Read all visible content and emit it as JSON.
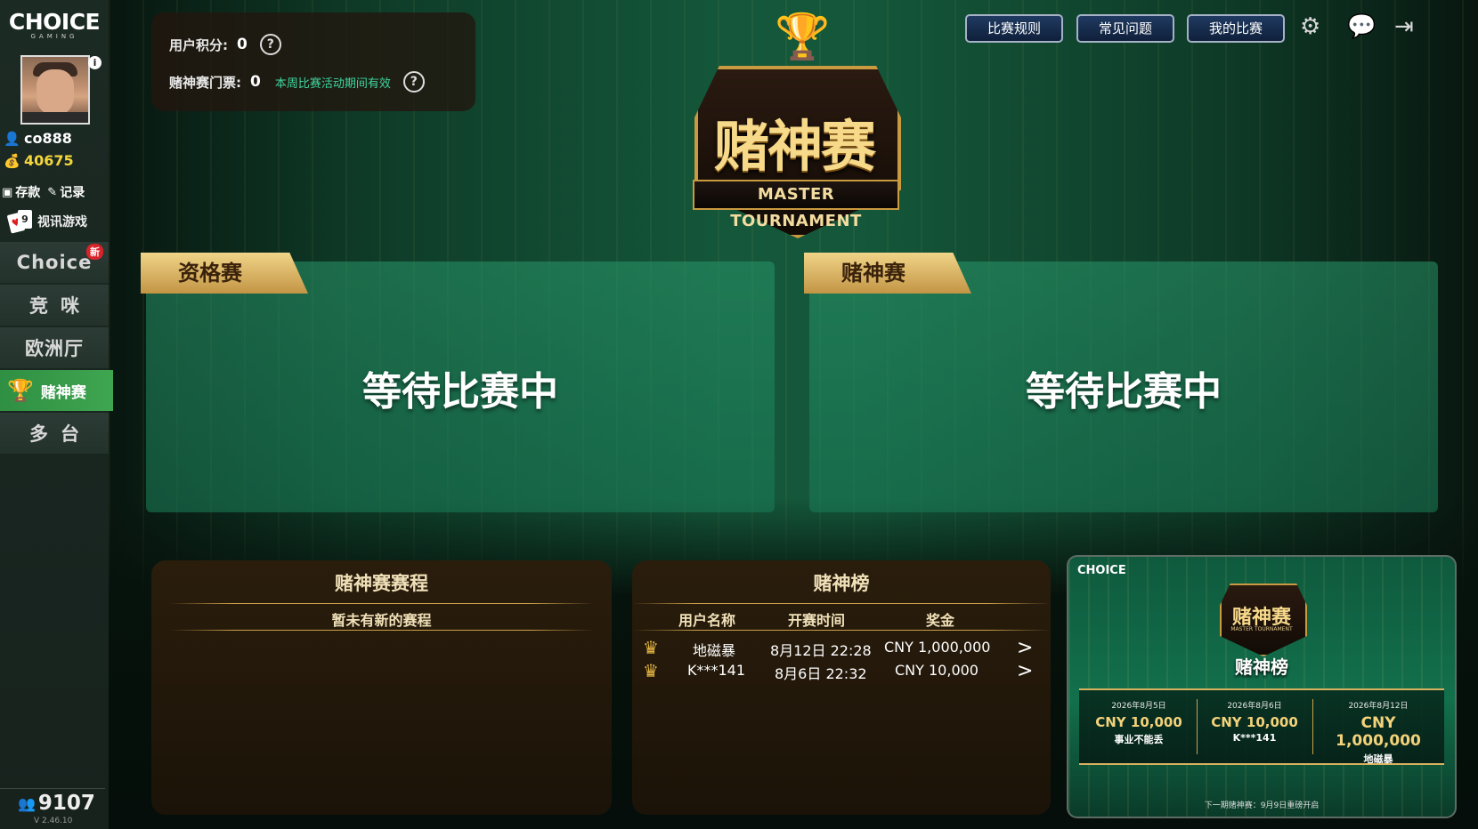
{
  "sidebar": {
    "logo_main": "CHOICE",
    "logo_sub": "GAMING",
    "info_icon": "i",
    "username": "co888",
    "balance": "40675",
    "deposit_label": "存款",
    "records_label": "记录",
    "video_games_label": "视讯游戏",
    "nav": [
      {
        "label": "Choice",
        "badge": "新"
      },
      {
        "label": "竞咪"
      },
      {
        "label": "欧洲厅"
      },
      {
        "label": "赌神赛",
        "active": true
      },
      {
        "label": "多台"
      }
    ],
    "online_count": "9107",
    "version": "V 2.46.10"
  },
  "info_box": {
    "points_label": "用户积分:",
    "points_value": "0",
    "ticket_label": "赌神赛门票:",
    "ticket_value": "0",
    "ticket_note": "本周比赛活动期间有效"
  },
  "header": {
    "rules_button": "比赛规则",
    "faq_button": "常见问题",
    "my_matches_button": "我的比赛"
  },
  "emblem": {
    "title": "赌神赛",
    "subtitle": "MASTER TOURNAMENT"
  },
  "panels": [
    {
      "tab": "资格赛",
      "status": "等待比赛中"
    },
    {
      "tab": "赌神赛",
      "status": "等待比赛中"
    }
  ],
  "schedule": {
    "title": "赌神赛赛程",
    "empty_text": "暂未有新的赛程"
  },
  "leaderboard": {
    "title": "赌神榜",
    "columns": [
      "用户名称",
      "开赛时间",
      "奖金"
    ],
    "rows": [
      {
        "user": "地磁暴",
        "time": "8月12日 22:28",
        "prize": "CNY 1,000,000"
      },
      {
        "user": "K***141",
        "time": "8月6日 22:32",
        "prize": "CNY 10,000"
      }
    ]
  },
  "promo": {
    "logo": "CHOICE",
    "emblem_title": "赌神赛",
    "emblem_sub": "MASTER TOURNAMENT",
    "heading": "赌神榜",
    "entries": [
      {
        "date": "2026年8月5日",
        "amount": "CNY 10,000",
        "name": "事业不能丢"
      },
      {
        "date": "2026年8月6日",
        "amount": "CNY 10,000",
        "name": "K***141"
      },
      {
        "date": "2026年8月12日",
        "amount": "CNY 1,000,000",
        "name": "地磁暴"
      }
    ],
    "footer": "下一期赌神赛：9月9日重磅开启"
  },
  "colors": {
    "accent_green": "#3fa650",
    "gold": "#c99a40",
    "note_green": "#3fd6a0",
    "balance_yellow": "#f4d63c"
  },
  "icons": [
    "user-icon",
    "money-bag-icon",
    "deposit-icon",
    "edit-icon",
    "cards-icon",
    "trophy-icon",
    "help-icon",
    "gear-icon",
    "chat-icon",
    "exit-icon",
    "crown-icon",
    "chevron-right-icon",
    "users-icon"
  ]
}
